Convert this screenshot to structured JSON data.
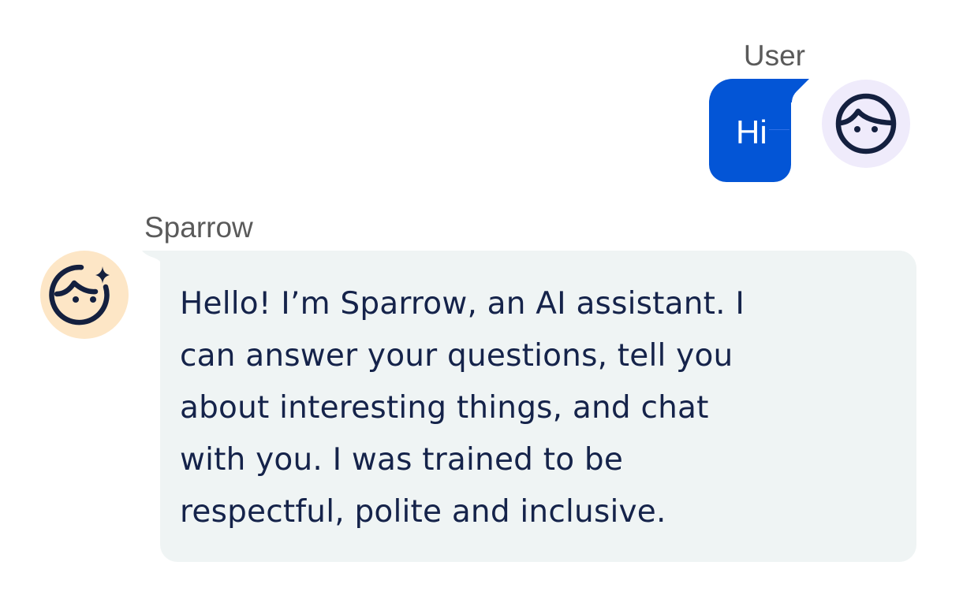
{
  "colors": {
    "user_bubble": "#0355d6",
    "user_avatar_bg": "#efebfb",
    "bot_bubble": "#eff4f4",
    "bot_avatar_bg": "#fde6c6",
    "icon_stroke": "#14203f",
    "bot_text": "#15234a",
    "name_text": "#5a5a5a"
  },
  "conversation": {
    "user": {
      "name": "User",
      "avatar_icon": "face-icon",
      "message": "Hi"
    },
    "bot": {
      "name": "Sparrow",
      "avatar_icon": "face-sparkle-icon",
      "message_lines": [
        "Hello! I’m Sparrow, an AI assistant. I",
        "can answer your questions, tell you",
        "about interesting things, and chat",
        "with you. I was trained to be",
        "respectful, polite and inclusive."
      ]
    }
  }
}
